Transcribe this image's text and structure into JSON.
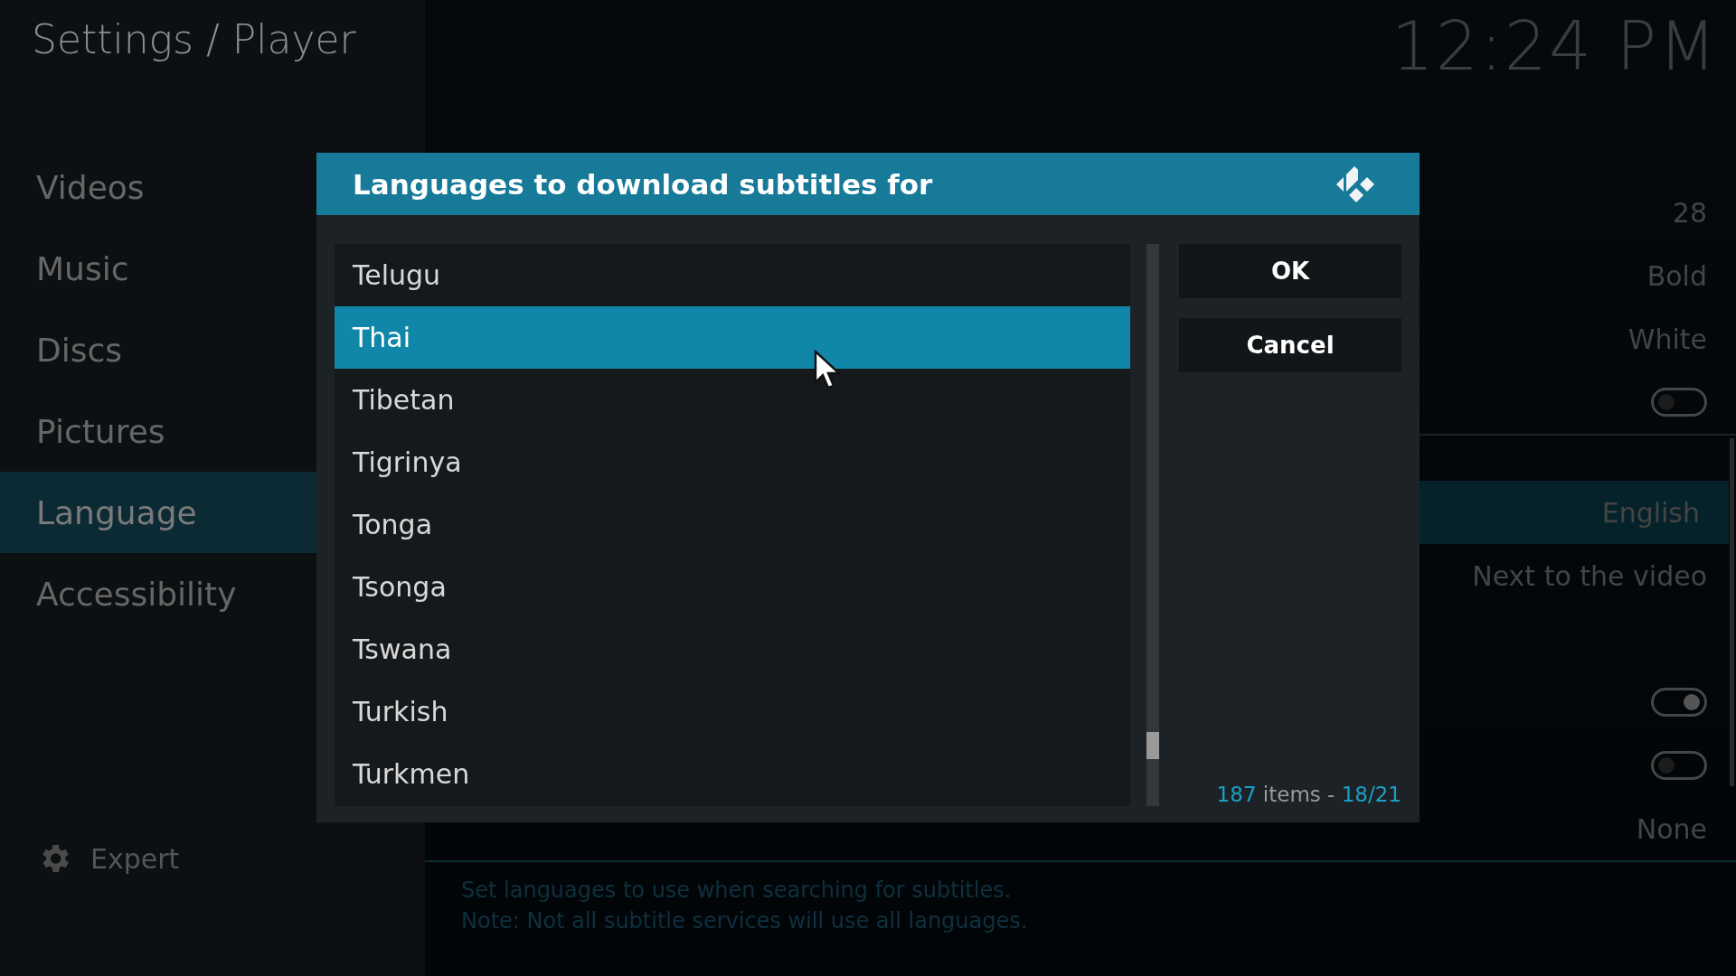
{
  "header": {
    "title": "Settings / Player",
    "clock": "12:24 PM"
  },
  "sidebar": {
    "items": [
      {
        "label": "Videos",
        "selected": false
      },
      {
        "label": "Music",
        "selected": false
      },
      {
        "label": "Discs",
        "selected": false
      },
      {
        "label": "Pictures",
        "selected": false
      },
      {
        "label": "Language",
        "selected": true
      },
      {
        "label": "Accessibility",
        "selected": false
      }
    ],
    "expert": {
      "label": "Expert"
    }
  },
  "settings": {
    "groups": [
      {
        "rows": [
          {
            "kind": "blank",
            "selected": false
          },
          {
            "kind": "value",
            "value": "28",
            "selected": false
          },
          {
            "kind": "value",
            "value": "Bold",
            "selected": false
          },
          {
            "kind": "value",
            "value": "White",
            "selected": false
          },
          {
            "kind": "toggle",
            "on": false,
            "selected": false
          }
        ]
      },
      {
        "rows": [
          {
            "kind": "value",
            "value": "English",
            "selected": true
          },
          {
            "kind": "value",
            "value": "Next to the video",
            "selected": false
          },
          {
            "kind": "blank",
            "selected": false
          },
          {
            "kind": "toggle",
            "on": true,
            "selected": false
          },
          {
            "kind": "toggle",
            "on": false,
            "selected": false
          },
          {
            "kind": "value",
            "value": "None",
            "selected": false
          }
        ]
      }
    ],
    "description": [
      "Set languages to use when searching for subtitles.",
      "Note: Not all subtitle services will use all languages."
    ]
  },
  "dialog": {
    "title": "Languages to download subtitles for",
    "items": [
      {
        "label": "Telugu",
        "selected": false
      },
      {
        "label": "Thai",
        "selected": true
      },
      {
        "label": "Tibetan",
        "selected": false
      },
      {
        "label": "Tigrinya",
        "selected": false
      },
      {
        "label": "Tonga",
        "selected": false
      },
      {
        "label": "Tsonga",
        "selected": false
      },
      {
        "label": "Tswana",
        "selected": false
      },
      {
        "label": "Turkish",
        "selected": false
      },
      {
        "label": "Turkmen",
        "selected": false
      }
    ],
    "buttons": [
      {
        "label": "OK"
      },
      {
        "label": "Cancel"
      }
    ],
    "footer": {
      "count": "187",
      "middle": "items -",
      "position": "18/21"
    }
  }
}
